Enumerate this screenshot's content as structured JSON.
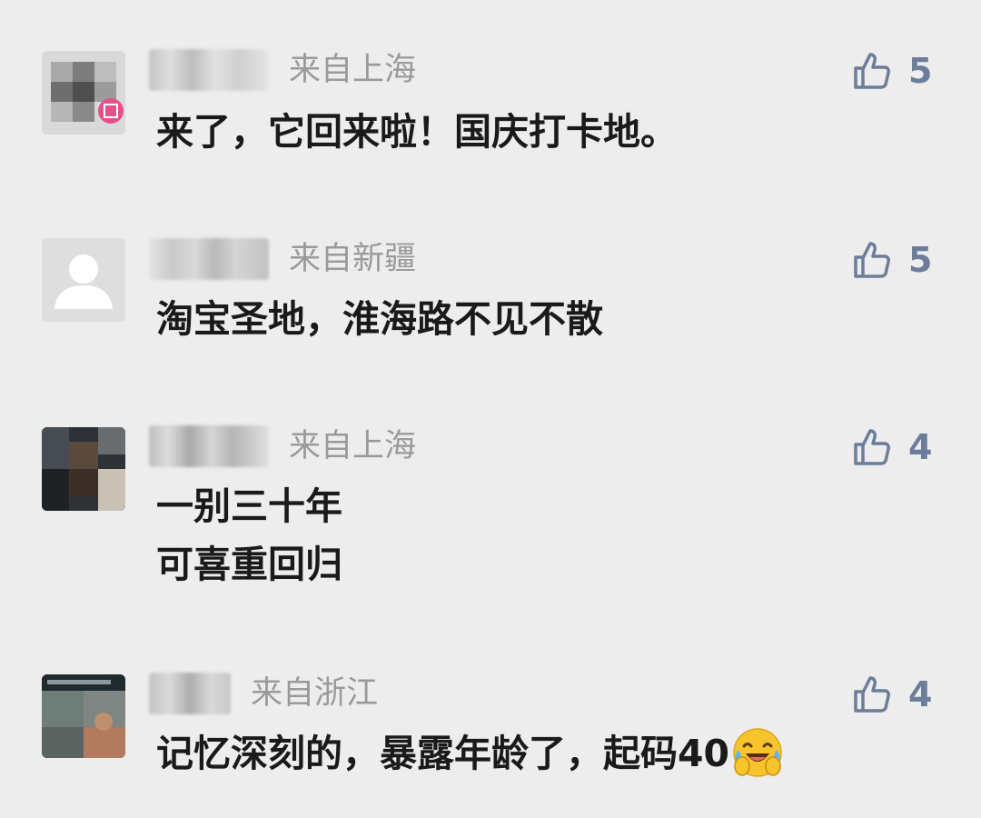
{
  "comments": [
    {
      "location": "来自上海",
      "likes": "5",
      "lines": [
        "来了，它回来啦！国庆打卡地。"
      ]
    },
    {
      "location": "来自新疆",
      "likes": "5",
      "lines": [
        "淘宝圣地，淮海路不见不散"
      ]
    },
    {
      "location": "来自上海",
      "likes": "4",
      "lines": [
        "一别三十年",
        "可喜重回归"
      ]
    },
    {
      "location": "来自浙江",
      "likes": "4",
      "lines": [
        "记忆深刻的，暴露年龄了，起码40"
      ],
      "trailing_emoji": "laughing-crying-emoji"
    }
  ],
  "icons": {
    "like": "thumbs-up-icon"
  },
  "colors": {
    "background": "#ededed",
    "location": "#9a9a9a",
    "like": "#6b7d99",
    "text": "#1a1a1a"
  }
}
